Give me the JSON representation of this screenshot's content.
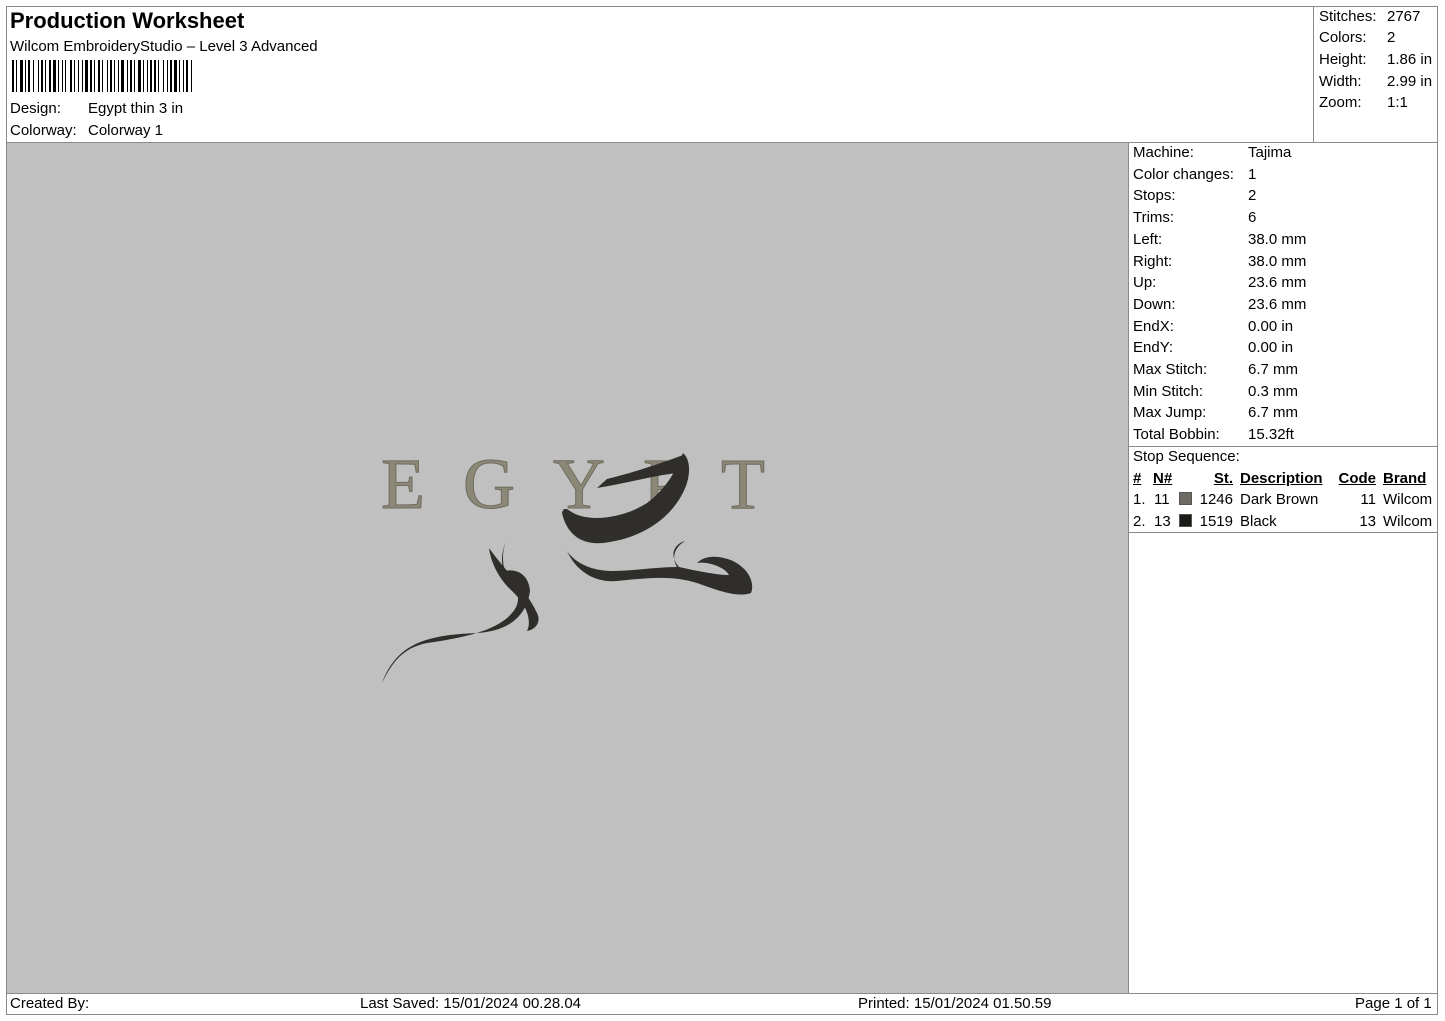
{
  "header": {
    "title": "Production Worksheet",
    "software": "Wilcom EmbroideryStudio – Level 3 Advanced",
    "design_label": "Design:",
    "design_value": "Egypt thin 3 in",
    "colorway_label": "Colorway:",
    "colorway_value": "Colorway 1"
  },
  "summary": {
    "stitches_label": "Stitches:",
    "stitches": "2767",
    "colors_label": "Colors:",
    "colors": "2",
    "height_label": "Height:",
    "height": "1.86 in",
    "width_label": "Width:",
    "width": "2.99 in",
    "zoom_label": "Zoom:",
    "zoom": "1:1"
  },
  "machine_info": [
    {
      "label": "Machine:",
      "value": "Tajima"
    },
    {
      "label": "Color changes:",
      "value": "1"
    },
    {
      "label": "Stops:",
      "value": "2"
    },
    {
      "label": "Trims:",
      "value": "6"
    },
    {
      "label": "Left:",
      "value": "38.0 mm"
    },
    {
      "label": "Right:",
      "value": "38.0 mm"
    },
    {
      "label": "Up:",
      "value": "23.6 mm"
    },
    {
      "label": "Down:",
      "value": "23.6 mm"
    },
    {
      "label": "EndX:",
      "value": "0.00 in"
    },
    {
      "label": "EndY:",
      "value": "0.00 in"
    },
    {
      "label": "Max Stitch:",
      "value": "6.7 mm"
    },
    {
      "label": "Min Stitch:",
      "value": "0.3 mm"
    },
    {
      "label": "Max Jump:",
      "value": "6.7 mm"
    },
    {
      "label": "Total Bobbin:",
      "value": "15.32ft"
    }
  ],
  "stop_sequence": {
    "title": "Stop Sequence:",
    "columns": [
      "#",
      "N#",
      "St.",
      "Description",
      "Code",
      "Brand"
    ],
    "rows": [
      {
        "idx": "1.",
        "needle": "11",
        "swatch_color": "#6e6a64",
        "stitches": "1246",
        "description": "Dark Brown",
        "code": "11",
        "brand": "Wilcom"
      },
      {
        "idx": "2.",
        "needle": "13",
        "swatch_color": "#1c1a17",
        "stitches": "1519",
        "description": "Black",
        "code": "13",
        "brand": "Wilcom"
      }
    ]
  },
  "design_preview": {
    "text": "EGYPT",
    "text_color": "#8c8878",
    "script_color": "#2f2e2a",
    "canvas_color": "#c0c0c0"
  },
  "footer": {
    "created_by": "Created By:",
    "last_saved": "Last Saved: 15/01/2024 00.28.04",
    "printed": "Printed: 15/01/2024 01.50.59",
    "page": "Page 1 of 1"
  }
}
